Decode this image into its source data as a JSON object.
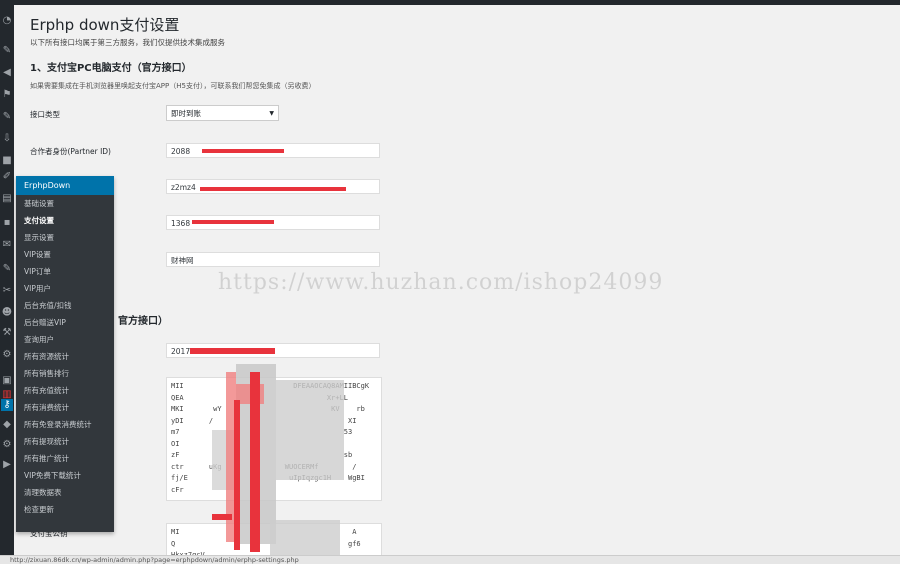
{
  "page": {
    "title": "Erphp down支付设置",
    "subtitle": "以下所有接口均属于第三方服务，我们仅提供技术集成服务"
  },
  "section1": {
    "heading": "1、支付宝PC电脑支付（官方接口）",
    "description": "如果需要集成在手机浏览器里唤起支付宝APP（H5支付），可联系我们帮您免集成（另收费）",
    "interface_type_label": "接口类型",
    "interface_type_value": "即时到账",
    "partner_id_label": "合作者身份(Partner ID)",
    "partner_id_value": "2088",
    "field2_value": "z2mz4",
    "field3_value": "1368",
    "field4_value": "财神网"
  },
  "section2": {
    "heading_partial": "官方接口）",
    "appid_value": "2017",
    "key1_text": "MII                          DFEAAOCAQ8AMIIBCgK\nQEA                                  Xr+LL\nMKI       wY                          KV    rb\nyDI      /                                XI\nm7                                       53\nOI                                        \nzF                                       sb\nctr      uKg               WUOCERMf        /\nfj/E                        uIpIqzgc1H    WgBI\ncFr",
    "key2_label_partial": "支付宝公钥",
    "key2_text": "MI                                         A\nQ                                         gf6\nHkxz7gcV"
  },
  "flyout": {
    "header": "ErphpDown",
    "items": [
      {
        "label": "基础设置"
      },
      {
        "label": "支付设置"
      },
      {
        "label": "显示设置"
      },
      {
        "label": "VIP设置"
      },
      {
        "label": "VIP订单"
      },
      {
        "label": "VIP用户"
      },
      {
        "label": "后台充值/扣钱"
      },
      {
        "label": "后台赠送VIP"
      },
      {
        "label": "查询用户"
      },
      {
        "label": "所有资源统计"
      },
      {
        "label": "所有销售排行"
      },
      {
        "label": "所有充值统计"
      },
      {
        "label": "所有消费统计"
      },
      {
        "label": "所有免登录消费统计"
      },
      {
        "label": "所有提现统计"
      },
      {
        "label": "所有推广统计"
      },
      {
        "label": "VIP免费下载统计"
      },
      {
        "label": "清理数据表"
      },
      {
        "label": "检查更新"
      }
    ]
  },
  "watermark": "https://www.huzhan.com/ishop24099",
  "statusbar": "http://zixuan.86dk.cn/wp-admin/admin.php?page=erphpdown/admin/erphp-settings.php",
  "icons": [
    "dashboard-icon",
    "pin-icon",
    "megaphone-icon",
    "flag-icon",
    "pin-icon",
    "download-icon",
    "video-icon",
    "brush-icon",
    "link-icon",
    "pages-icon",
    "comments-icon",
    "mail-icon",
    "pin-icon",
    "tools-icon",
    "plugin-icon",
    "users-icon",
    "wrench-icon",
    "settings-icon",
    "media-icon",
    "key-icon",
    "shield-icon",
    "gear-icon",
    "grid-icon",
    "play-icon"
  ],
  "colors": {
    "admin_bar": "#23282d",
    "accent": "#0073aa",
    "redaction": "#e8333c"
  }
}
